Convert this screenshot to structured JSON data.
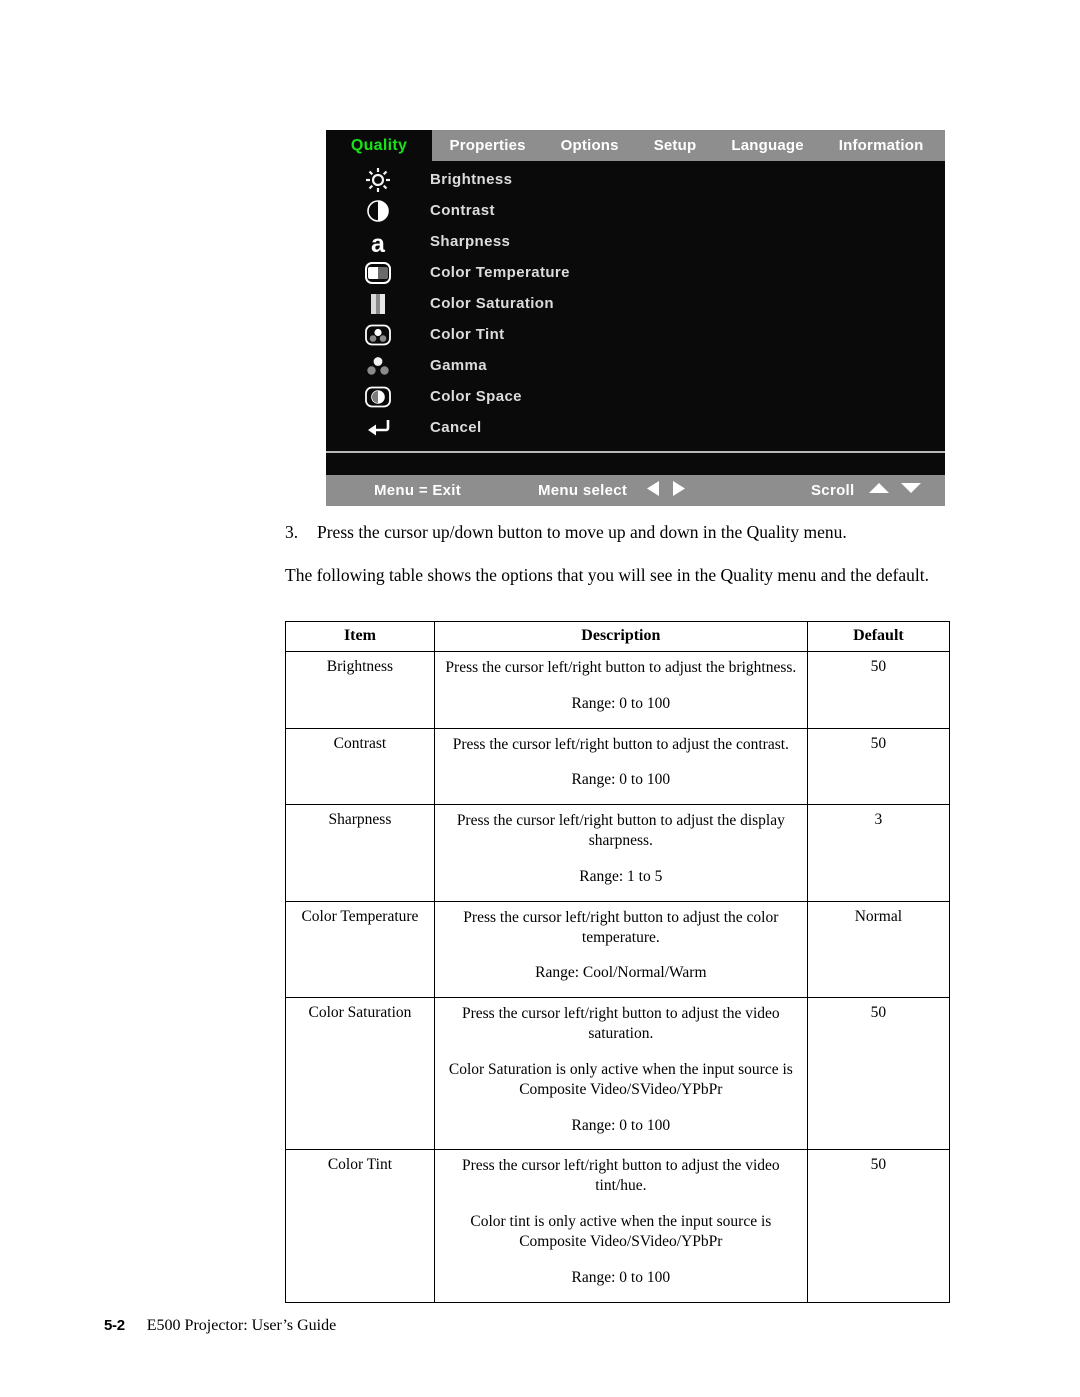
{
  "osd": {
    "active_tab": "Quality",
    "tabs": [
      "Properties",
      "Options",
      "Setup",
      "Language",
      "Information"
    ],
    "accent_color": "#17e417",
    "tabbar_bg": "#8e8e8e",
    "panel_bg": "#0a0a0a",
    "items": [
      {
        "label": "Brightness",
        "icon": "brightness-icon"
      },
      {
        "label": "Contrast",
        "icon": "contrast-icon"
      },
      {
        "label": "Sharpness",
        "icon": "sharpness-icon"
      },
      {
        "label": "Color Temperature",
        "icon": "color-temperature-icon"
      },
      {
        "label": "Color Saturation",
        "icon": "color-saturation-icon"
      },
      {
        "label": "Color Tint",
        "icon": "color-tint-icon"
      },
      {
        "label": "Gamma",
        "icon": "gamma-icon"
      },
      {
        "label": "Color Space",
        "icon": "color-space-icon"
      },
      {
        "label": "Cancel",
        "icon": "return-arrow-icon"
      }
    ],
    "footer": {
      "exit": "Menu = Exit",
      "select": "Menu select",
      "scroll": "Scroll"
    }
  },
  "content": {
    "step_number": "3.",
    "step_text": "Press the cursor up/down button to move up and down in the Quality menu.",
    "paragraph": "The following table shows the options that you will see in the Quality menu and the default."
  },
  "table": {
    "headers": [
      "Item",
      "Description",
      "Default"
    ],
    "rows": [
      {
        "item": "Brightness",
        "desc": [
          "Press the cursor left/right button to adjust the brightness.",
          "Range: 0 to 100"
        ],
        "default": "50"
      },
      {
        "item": "Contrast",
        "desc": [
          "Press the cursor left/right button to adjust the contrast.",
          "Range: 0 to 100"
        ],
        "default": "50"
      },
      {
        "item": "Sharpness",
        "desc": [
          "Press the cursor left/right button to adjust the display sharpness.",
          "Range: 1 to 5"
        ],
        "default": "3"
      },
      {
        "item": "Color Temperature",
        "desc": [
          "Press the cursor left/right button to adjust the color temperature.",
          "Range: Cool/Normal/Warm"
        ],
        "default": "Normal"
      },
      {
        "item": "Color Saturation",
        "desc": [
          "Press the cursor left/right button to adjust the video saturation.",
          "Color Saturation is only active when the input source is Composite Video/SVideo/YPbPr",
          "Range: 0 to 100"
        ],
        "default": "50"
      },
      {
        "item": "Color Tint",
        "desc": [
          "Press the cursor left/right button to adjust the video tint/hue.",
          "Color tint is only active when the input source is Composite Video/SVideo/YPbPr",
          "Range: 0 to 100"
        ],
        "default": "50"
      }
    ]
  },
  "page_footer": {
    "page_number": "5-2",
    "title": "E500 Projector: User’s Guide"
  }
}
